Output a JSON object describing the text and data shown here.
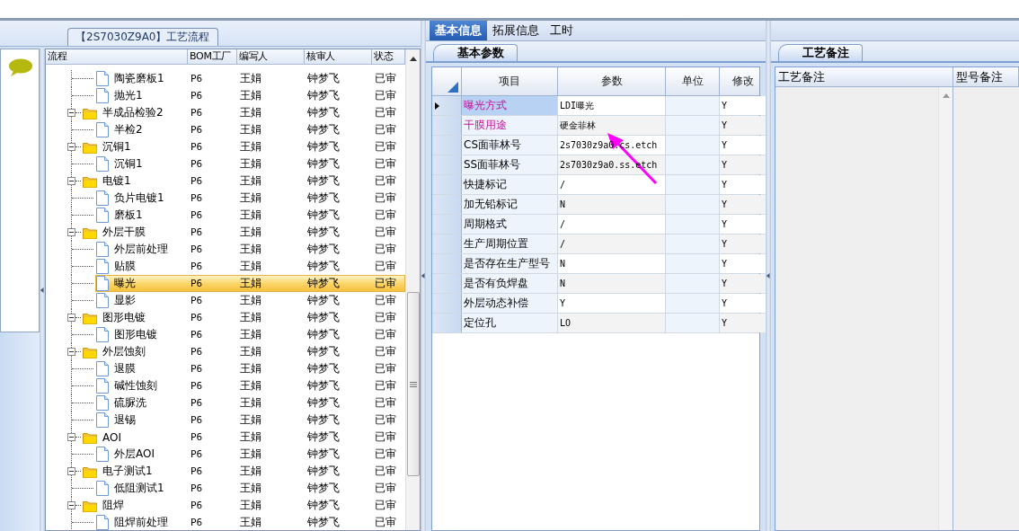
{
  "flow_panel": {
    "title": "【2S7030Z9A0】工艺流程",
    "columns": [
      "流程",
      "BOM工厂",
      "编写人",
      "核审人",
      "状态"
    ],
    "groups": [
      {
        "children": [
          {
            "label": "陶瓷磨板1",
            "factory": "P6",
            "writer": "王娟",
            "reviewer": "钟梦飞",
            "status": "已审",
            "selected": false
          },
          {
            "label": "抛光1",
            "factory": "P6",
            "writer": "王娟",
            "reviewer": "钟梦飞",
            "status": "已审",
            "selected": false
          }
        ]
      },
      {
        "label": "半成品检验2",
        "factory": "P6",
        "writer": "王娟",
        "reviewer": "钟梦飞",
        "status": "已审",
        "selected": false,
        "expanded": true,
        "children": [
          {
            "label": "半检2",
            "factory": "P6",
            "writer": "王娟",
            "reviewer": "钟梦飞",
            "status": "已审",
            "selected": false
          }
        ]
      },
      {
        "label": "沉铜1",
        "factory": "P6",
        "writer": "王娟",
        "reviewer": "钟梦飞",
        "status": "已审",
        "selected": false,
        "expanded": true,
        "children": [
          {
            "label": "沉铜1",
            "factory": "P6",
            "writer": "王娟",
            "reviewer": "钟梦飞",
            "status": "已审",
            "selected": false
          }
        ]
      },
      {
        "label": "电镀1",
        "factory": "P6",
        "writer": "王娟",
        "reviewer": "钟梦飞",
        "status": "已审",
        "selected": false,
        "expanded": true,
        "children": [
          {
            "label": "负片电镀1",
            "factory": "P6",
            "writer": "王娟",
            "reviewer": "钟梦飞",
            "status": "已审",
            "selected": false
          },
          {
            "label": "磨板1",
            "factory": "P6",
            "writer": "王娟",
            "reviewer": "钟梦飞",
            "status": "已审",
            "selected": false
          }
        ]
      },
      {
        "label": "外层干膜",
        "factory": "P6",
        "writer": "王娟",
        "reviewer": "钟梦飞",
        "status": "已审",
        "selected": false,
        "expanded": true,
        "children": [
          {
            "label": "外层前处理",
            "factory": "P6",
            "writer": "王娟",
            "reviewer": "钟梦飞",
            "status": "已审",
            "selected": false
          },
          {
            "label": "贴膜",
            "factory": "P6",
            "writer": "王娟",
            "reviewer": "钟梦飞",
            "status": "已审",
            "selected": false
          },
          {
            "label": "曝光",
            "factory": "P6",
            "writer": "王娟",
            "reviewer": "钟梦飞",
            "status": "已审",
            "selected": true
          },
          {
            "label": "显影",
            "factory": "P6",
            "writer": "王娟",
            "reviewer": "钟梦飞",
            "status": "已审",
            "selected": false
          }
        ]
      },
      {
        "label": "图形电镀",
        "factory": "P6",
        "writer": "王娟",
        "reviewer": "钟梦飞",
        "status": "已审",
        "selected": false,
        "expanded": true,
        "children": [
          {
            "label": "图形电镀",
            "factory": "P6",
            "writer": "王娟",
            "reviewer": "钟梦飞",
            "status": "已审",
            "selected": false
          }
        ]
      },
      {
        "label": "外层蚀刻",
        "factory": "P6",
        "writer": "王娟",
        "reviewer": "钟梦飞",
        "status": "已审",
        "selected": false,
        "expanded": true,
        "children": [
          {
            "label": "退膜",
            "factory": "P6",
            "writer": "王娟",
            "reviewer": "钟梦飞",
            "status": "已审",
            "selected": false
          },
          {
            "label": "碱性蚀刻",
            "factory": "P6",
            "writer": "王娟",
            "reviewer": "钟梦飞",
            "status": "已审",
            "selected": false
          },
          {
            "label": "硫脲洗",
            "factory": "P6",
            "writer": "王娟",
            "reviewer": "钟梦飞",
            "status": "已审",
            "selected": false
          },
          {
            "label": "退锡",
            "factory": "P6",
            "writer": "王娟",
            "reviewer": "钟梦飞",
            "status": "已审",
            "selected": false
          }
        ]
      },
      {
        "label": "AOI",
        "factory": "P6",
        "writer": "王娟",
        "reviewer": "钟梦飞",
        "status": "已审",
        "selected": false,
        "expanded": true,
        "children": [
          {
            "label": "外层AOI",
            "factory": "P6",
            "writer": "王娟",
            "reviewer": "钟梦飞",
            "status": "已审",
            "selected": false
          }
        ]
      },
      {
        "label": "电子测试1",
        "factory": "P6",
        "writer": "王娟",
        "reviewer": "钟梦飞",
        "status": "已审",
        "selected": false,
        "expanded": true,
        "children": [
          {
            "label": "低阻测试1",
            "factory": "P6",
            "writer": "王娟",
            "reviewer": "钟梦飞",
            "status": "已审",
            "selected": false
          }
        ]
      },
      {
        "label": "阻焊",
        "factory": "P6",
        "writer": "王娟",
        "reviewer": "钟梦飞",
        "status": "已审",
        "selected": false,
        "expanded": true,
        "children": [
          {
            "label": "阻焊前处理",
            "factory": "P6",
            "writer": "王娟",
            "reviewer": "钟梦飞",
            "status": "已审",
            "selected": false
          }
        ]
      }
    ]
  },
  "info_tabs": [
    {
      "label": "基本信息",
      "selected": true
    },
    {
      "label": "拓展信息",
      "selected": false
    },
    {
      "label": "工时",
      "selected": false
    }
  ],
  "params_panel": {
    "tab": "基本参数",
    "columns": [
      "项目",
      "参数",
      "单位",
      "修改"
    ],
    "rows": [
      {
        "item": "曝光方式",
        "value": "LDI曝光",
        "modify": "Y",
        "required": true,
        "current": true
      },
      {
        "item": "干膜用途",
        "value": "硬金菲林",
        "modify": "Y",
        "required": true,
        "current": false
      },
      {
        "item": "CS面菲林号",
        "value": "2s7030z9a0.cs.etch",
        "modify": "Y",
        "required": false,
        "current": false
      },
      {
        "item": "SS面菲林号",
        "value": "2s7030z9a0.ss.etch",
        "modify": "Y",
        "required": false,
        "current": false
      },
      {
        "item": "快捷标记",
        "value": "/",
        "modify": "Y",
        "required": false,
        "current": false
      },
      {
        "item": "加无铅标记",
        "value": "N",
        "modify": "Y",
        "required": false,
        "current": false
      },
      {
        "item": "周期格式",
        "value": "/",
        "modify": "Y",
        "required": false,
        "current": false
      },
      {
        "item": "生产周期位置",
        "value": "/",
        "modify": "Y",
        "required": false,
        "current": false
      },
      {
        "item": "是否存在生产型号",
        "value": "N",
        "modify": "Y",
        "required": false,
        "current": false
      },
      {
        "item": "是否有负焊盘",
        "value": "N",
        "modify": "Y",
        "required": false,
        "current": false
      },
      {
        "item": "外层动态补偿",
        "value": "Y",
        "modify": "Y",
        "required": false,
        "current": false
      },
      {
        "item": "定位孔",
        "value": "LO",
        "modify": "Y",
        "required": false,
        "current": false
      }
    ]
  },
  "notes_panel": {
    "tab": "工艺备注",
    "columns": [
      "工艺备注",
      "型号备注"
    ]
  }
}
